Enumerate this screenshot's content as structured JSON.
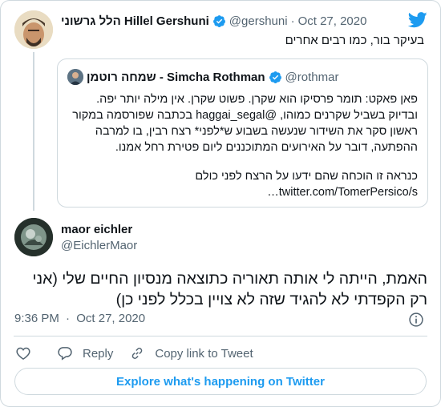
{
  "tweet1": {
    "author_name": "הלל גרשוני Hillel Gershuni",
    "handle": "@gershuni",
    "separator": "·",
    "date": "Oct 27, 2020",
    "text": "בעיקר בור, כמו רבים אחרים"
  },
  "quoted": {
    "author_name": "שמחה רוטמן - Simcha Rothman",
    "handle": "@rothmar",
    "lines": [
      "פאן פאקט: תומר פרסיקו הוא שקרן. פשוט שקרן. אין מילה יותר יפה.",
      "ובדיוק בשביל שקרנים כמוהו, @haggai_segal בכתבה שפורסמה במקור",
      "ראשון סקר את השידור שנעשה בשבוע ש*לפני* רצח רבין, בו למרבה",
      "ההפתעה, דובר על האירועים המתוכננים ליום פטירת רחל אמנו.",
      "כנראה זו הוכחה שהם ידעו על הרצח לפני כולם",
      "twitter.com/TomerPersico/s…"
    ]
  },
  "tweet2": {
    "author_name": "maor eichler",
    "handle": "@EichlerMaor",
    "text": "האמת, הייתה לי אותה תאוריה כתוצאה מנסיון החיים שלי (אני רק הקפדתי לא להגיד שזה לא צויין בכלל לפני כן)",
    "time": "9:36 PM",
    "separator": "·",
    "date": "Oct 27, 2020"
  },
  "actions": {
    "reply_label": "Reply",
    "copy_link_label": "Copy link to Tweet"
  },
  "explore_label": "Explore what's happening on Twitter",
  "colors": {
    "accent": "#1d9bf0",
    "text_primary": "#0f1419",
    "text_secondary": "#536471",
    "border": "#cfd9de"
  },
  "icons": [
    "twitter-bird-icon",
    "verified-badge-icon",
    "info-icon",
    "heart-icon",
    "reply-icon",
    "link-icon"
  ]
}
